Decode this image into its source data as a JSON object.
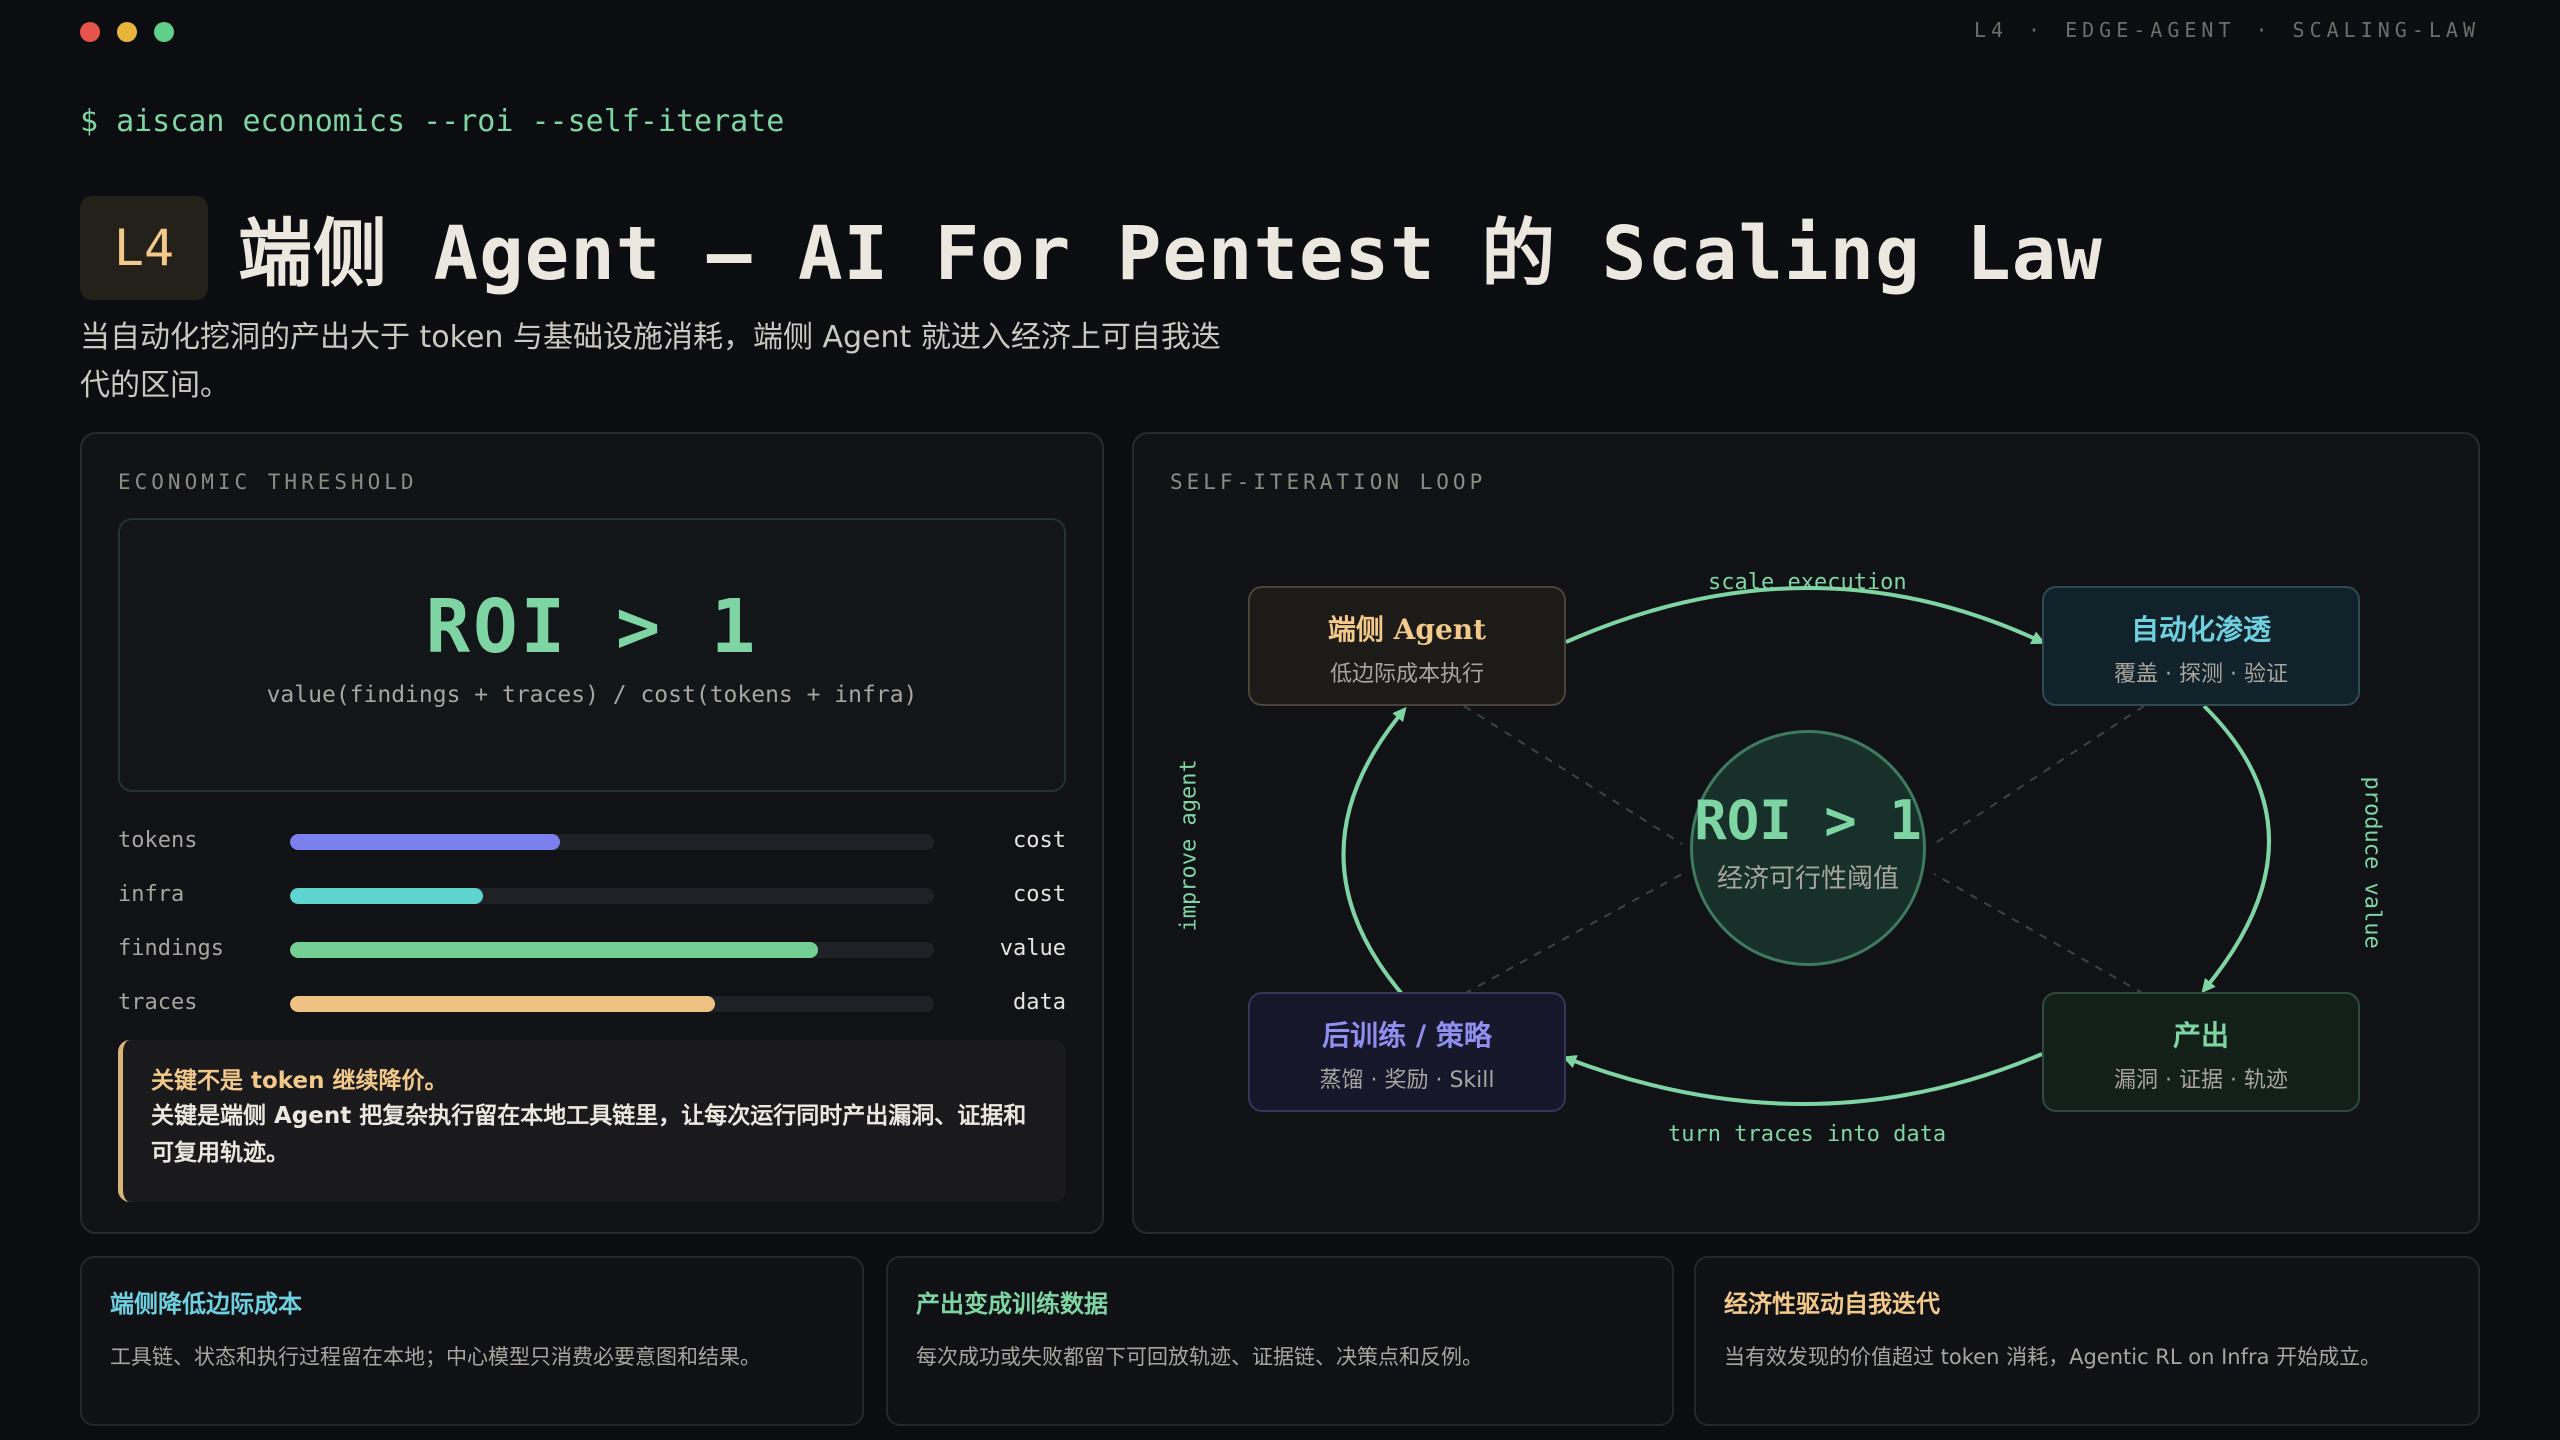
{
  "window": {
    "dots": [
      "#e5534b",
      "#e8b43c",
      "#5fcf8a"
    ],
    "crumbs": [
      "L4",
      "·",
      "EDGE-AGENT",
      "·",
      "SCALING-LAW"
    ]
  },
  "command": {
    "prompt": "$",
    "text": "aiscan economics --roi --self-iterate"
  },
  "header": {
    "level": "L4",
    "title": "端侧 Agent — AI For Pentest 的 Scaling Law",
    "subtitle": "当自动化挖洞的产出大于 token 与基础设施消耗，端侧 Agent 就进入经济上可自我迭代的区间。"
  },
  "threshold": {
    "label": "ECONOMIC THRESHOLD",
    "roi": "ROI > 1",
    "formula": "value(findings + traces) / cost(tokens + infra)",
    "bars": [
      {
        "name": "tokens",
        "kind": "cost",
        "level": 0.42,
        "color": "#7b80ee"
      },
      {
        "name": "infra",
        "kind": "cost",
        "level": 0.3,
        "color": "#5fd3cf"
      },
      {
        "name": "findings",
        "kind": "value",
        "level": 0.82,
        "color": "#74cf95"
      },
      {
        "name": "traces",
        "kind": "data",
        "level": 0.66,
        "color": "#eec283"
      }
    ],
    "note_title": "关键不是 token 继续降价。",
    "note_body": "关键是端侧 Agent 把复杂执行留在本地工具链里，让每次运行同时产出漏洞、证据和可复用轨迹。"
  },
  "loop": {
    "label": "SELF-ITERATION LOOP",
    "nodes": {
      "agent": {
        "title": "端侧 Agent",
        "sub": "低边际成本执行",
        "color": "#f2c98b"
      },
      "pentest": {
        "title": "自动化渗透",
        "sub": "覆盖 · 探测 · 验证",
        "color": "#6fd0e0"
      },
      "output": {
        "title": "产出",
        "sub": "漏洞 · 证据 · 轨迹",
        "color": "#7fd4a3"
      },
      "training": {
        "title": "后训练 / 策略",
        "sub": "蒸馏 · 奖励 · Skill",
        "color": "#8f8ff0"
      }
    },
    "edges": {
      "top": "scale execution",
      "right": "produce value",
      "bottom": "turn traces into data",
      "left": "improve agent"
    },
    "center": {
      "roi": "ROI > 1",
      "sub": "经济可行性阈值"
    }
  },
  "cards": [
    {
      "title": "端侧降低边际成本",
      "body": "工具链、状态和执行过程留在本地；中心模型只消费必要意图和结果。",
      "color": "#6fd0e0"
    },
    {
      "title": "产出变成训练数据",
      "body": "每次成功或失败都留下可回放轨迹、证据链、决策点和反例。",
      "color": "#7fd4a3"
    },
    {
      "title": "经济性驱动自我迭代",
      "body": "当有效发现的价值超过 token 消耗，Agentic RL on Infra 开始成立。",
      "color": "#f2c98b"
    }
  ]
}
